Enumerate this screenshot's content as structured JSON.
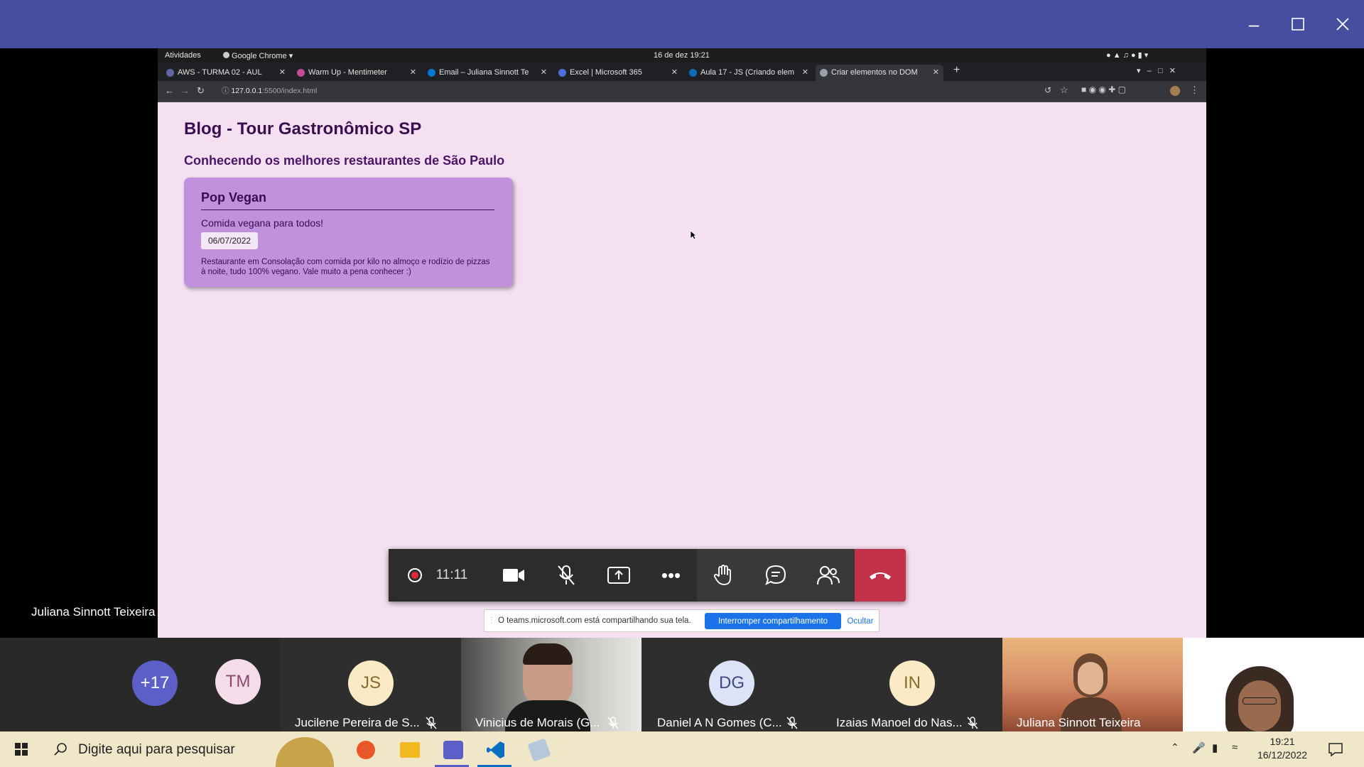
{
  "gnome": {
    "activities": "Atividades",
    "app_menu": "Google Chrome",
    "clock": "16 de dez  19:21"
  },
  "tabs": [
    {
      "label": "AWS - TURMA 02 - AUL",
      "color": "#6264a7"
    },
    {
      "label": "Warm Up - Mentimeter",
      "color": "#c64a9b"
    },
    {
      "label": "Email – Juliana Sinnott Te",
      "color": "#0078d4"
    },
    {
      "label": "Excel | Microsoft 365",
      "color": "#4c6fe0"
    },
    {
      "label": "Aula 17 - JS (Criando elem",
      "color": "#0f6cbd"
    },
    {
      "label": "Criar elementos no DOM",
      "color": "#9aa0a6"
    }
  ],
  "address": {
    "host": "127.0.0.1",
    "path": ":5500/index.html"
  },
  "blog": {
    "title": "Blog - Tour Gastronômico SP",
    "subtitle": "Conhecendo os melhores restaurantes de São Paulo",
    "card": {
      "title": "Pop Vegan",
      "tagline": "Comida vegana para todos!",
      "date": "06/07/2022",
      "description": "Restaurante em Consolação com comida por kilo no almoço e rodízio de pizzas à noite, tudo 100% vegano. Vale muito a pena conhecer :)"
    }
  },
  "presenter_name": "Juliana Sinnott Teixeira",
  "meeting": {
    "timer": "11:11",
    "share_notice": "O teams.microsoft.com está compartilhando sua tela.",
    "stop_sharing": "Interromper compartilhamento",
    "hide": "Ocultar"
  },
  "participants": {
    "overflow": "+17",
    "tm_initials": "TM",
    "list": [
      {
        "initials": "JS",
        "name": "Jucilene Pereira de S...",
        "avatar_color": "#fbeac6",
        "text_color": "#8a6a2a"
      },
      {
        "initials": "",
        "name": "Vinicius de Morais (G...",
        "avatar_color": "",
        "text_color": ""
      },
      {
        "initials": "DG",
        "name": "Daniel A N Gomes (C...",
        "avatar_color": "#dde3f7",
        "text_color": "#3f4a82"
      },
      {
        "initials": "IN",
        "name": "Izaias Manoel do Nas...",
        "avatar_color": "#fbeac6",
        "text_color": "#8a6a2a"
      },
      {
        "initials": "",
        "name": "Juliana Sinnott Teixeira",
        "avatar_color": "",
        "text_color": ""
      }
    ]
  },
  "taskbar": {
    "search_placeholder": "Digite aqui para pesquisar",
    "time": "19:21",
    "date": "16/12/2022"
  }
}
